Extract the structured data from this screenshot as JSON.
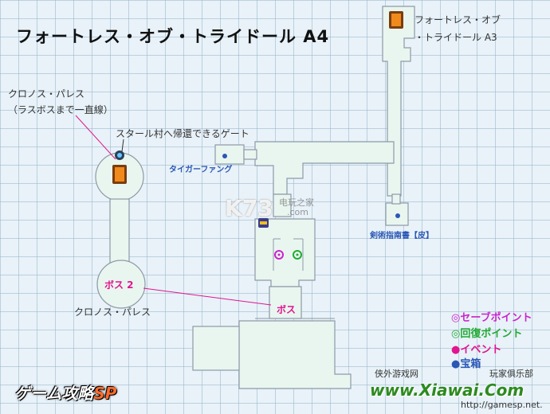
{
  "title": "フォートレス・オブ・トライドール A4",
  "exit_top_right": "フォートレス・オブ\n・トライドール A3",
  "kronos_palace_label": "クロノス・パレス\n（ラスボスまで一直線）",
  "return_gate_label": "スタール村へ帰還できるゲート",
  "tiger_fang_label": "タイガーファング",
  "sword_manual_label": "剣術指南書【皮】",
  "boss2_label": "ボス 2",
  "kronos_palace_bottom": "クロノス・パレス",
  "boss_label": "ボス",
  "watermark_k73": "K73",
  "watermark_cn": "电玩之家",
  "watermark_com": ".com",
  "legend": [
    {
      "text": "◎セーブポイント",
      "color": "#cc22cc"
    },
    {
      "text": "◎回復ポイント",
      "color": "#22aa33"
    },
    {
      "text": "●イベント",
      "color": "#e0158f"
    },
    {
      "text": "●宝箱",
      "color": "#2b57b5"
    }
  ],
  "credits": {
    "site_cn": "侠外游戏网",
    "club": "玩家俱乐部",
    "url": "http://gamesp.net.",
    "brand_left": "ゲーム攻略",
    "brand_left_sp": "SP",
    "brand_right": "www.Xiawai.Com"
  },
  "colors": {
    "floor": "#e9f6f0",
    "floor_stroke": "#9aa6b0",
    "pink": "#e0158f",
    "blue": "#2b57b5"
  }
}
